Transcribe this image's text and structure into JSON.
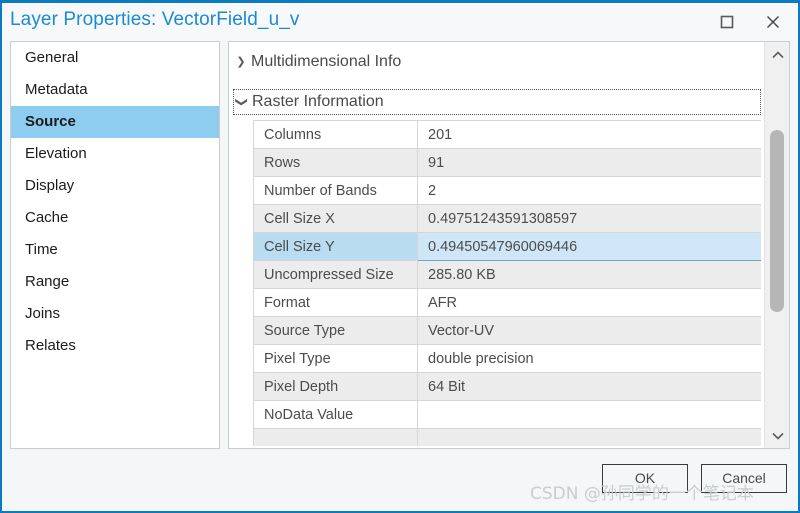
{
  "window": {
    "title": "Layer Properties: VectorField_u_v",
    "title_color": "#1c8ad4",
    "border_color": "#0b7bc1",
    "maximize_icon": "maximize-icon",
    "close_icon": "close-icon"
  },
  "sidebar": {
    "items": [
      {
        "label": "General",
        "selected": false
      },
      {
        "label": "Metadata",
        "selected": false
      },
      {
        "label": "Source",
        "selected": true
      },
      {
        "label": "Elevation",
        "selected": false
      },
      {
        "label": "Display",
        "selected": false
      },
      {
        "label": "Cache",
        "selected": false
      },
      {
        "label": "Time",
        "selected": false
      },
      {
        "label": "Range",
        "selected": false
      },
      {
        "label": "Joins",
        "selected": false
      },
      {
        "label": "Relates",
        "selected": false
      }
    ],
    "selected_background": "#8ecdf0"
  },
  "content": {
    "sections": [
      {
        "label": "Multidimensional Info",
        "expanded": false,
        "chevron": "chevron-right-icon"
      },
      {
        "label": "Raster Information",
        "expanded": true,
        "chevron": "chevron-down-icon",
        "focused": true
      }
    ],
    "table": {
      "rows": [
        {
          "key": "Columns",
          "value": "201",
          "selected": false
        },
        {
          "key": "Rows",
          "value": "91",
          "selected": false
        },
        {
          "key": "Number of Bands",
          "value": "2",
          "selected": false
        },
        {
          "key": "Cell Size X",
          "value": "0.49751243591308597",
          "selected": false
        },
        {
          "key": "Cell Size Y",
          "value": "0.49450547960069446",
          "selected": true
        },
        {
          "key": "Uncompressed Size",
          "value": "285.80 KB",
          "selected": false
        },
        {
          "key": "Format",
          "value": "AFR",
          "selected": false
        },
        {
          "key": "Source Type",
          "value": "Vector-UV",
          "selected": false
        },
        {
          "key": "Pixel Type",
          "value": "double precision",
          "selected": false
        },
        {
          "key": "Pixel Depth",
          "value": "64 Bit",
          "selected": false
        },
        {
          "key": "NoData Value",
          "value": "",
          "selected": false
        },
        {
          "key": "",
          "value": "",
          "selected": false
        }
      ],
      "selected_row_background": "#cfe6f7"
    },
    "scrollbar": {
      "up_icon": "chevron-up-icon",
      "down_icon": "chevron-down-icon",
      "thumb": "scrollbar-thumb"
    }
  },
  "footer": {
    "ok_label": "OK",
    "cancel_label": "Cancel"
  },
  "watermark": {
    "text": "CSDN @孙同学的一个笔记本"
  }
}
